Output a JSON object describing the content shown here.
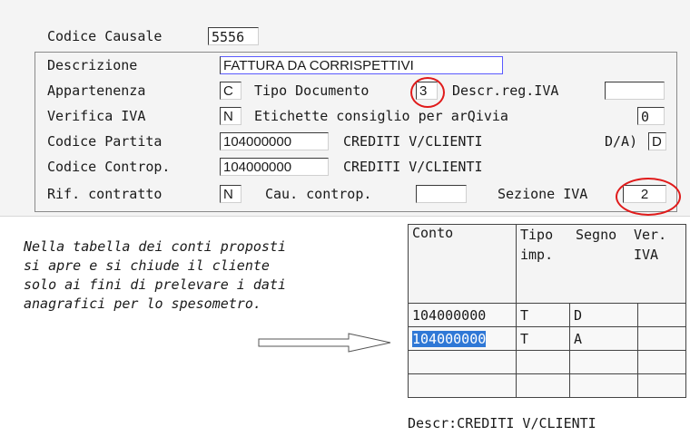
{
  "form": {
    "codice_causale_label": "Codice Causale",
    "codice_causale_value": "5556",
    "descrizione_label": "Descrizione",
    "descrizione_value": "FATTURA DA CORRISPETTIVI",
    "appartenenza_label": "Appartenenza",
    "appartenenza_value": "C",
    "tipo_documento_label": "Tipo Documento",
    "tipo_documento_value": "3",
    "descr_reg_iva_label": "Descr.reg.IVA",
    "descr_reg_iva_value": "",
    "verifica_iva_label": "Verifica IVA",
    "verifica_iva_value": "N",
    "etichette_label": "Etichette consiglio per arQivia",
    "etichette_value": "0",
    "codice_partita_label": "Codice Partita",
    "codice_partita_value": "104000000",
    "codice_partita_desc": "CREDITI V/CLIENTI",
    "da_label": "D/A)",
    "da_value": "D",
    "codice_controp_label": "Codice Controp.",
    "codice_controp_value": "104000000",
    "codice_controp_desc": "CREDITI V/CLIENTI",
    "rif_contratto_label": "Rif. contratto",
    "rif_contratto_value": "N",
    "cau_controp_label": "Cau. controp.",
    "cau_controp_value": "",
    "sezione_iva_label": "Sezione IVA",
    "sezione_iva_value": "2"
  },
  "note_text": "Nella tabella dei conti proposti\nsi apre e si chiude il cliente\nsolo ai fini di prelevare i dati\nanagrafici per lo spesometro.",
  "grid": {
    "headers": [
      "Conto",
      "Tipo\nimp.",
      "Segno",
      "Ver.\nIVA"
    ],
    "rows": [
      [
        "104000000",
        "T",
        "D",
        ""
      ],
      [
        "104000000",
        "T",
        "A",
        ""
      ],
      [
        "",
        "",
        "",
        ""
      ],
      [
        "",
        "",
        "",
        ""
      ]
    ],
    "descr_label": "Descr:CREDITI V/CLIENTI"
  },
  "colors": {
    "highlight": "#e01b1b",
    "selection": "#2f78d6"
  },
  "icons": {
    "arrow": "right-arrow-icon"
  }
}
